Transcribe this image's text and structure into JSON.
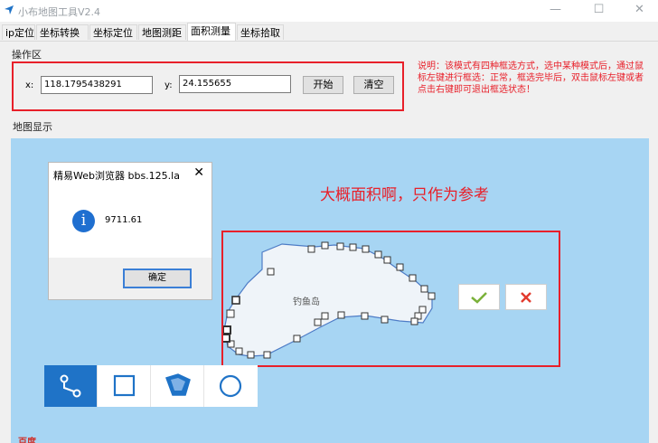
{
  "window": {
    "title": "小布地图工具V2.4",
    "minimize": "—",
    "maximize": "☐",
    "close": "✕"
  },
  "tabs": [
    {
      "label": "ip定位",
      "active": false
    },
    {
      "label": "坐标转换",
      "active": false
    },
    {
      "label": "坐标定位",
      "active": false
    },
    {
      "label": "地图测距",
      "active": false
    },
    {
      "label": "面积测量",
      "active": true
    },
    {
      "label": "坐标拾取",
      "active": false
    }
  ],
  "operation": {
    "section_label": "操作区",
    "x_label": "x:",
    "x_value": "118.1795438291",
    "y_label": "y:",
    "y_value": "24.155655",
    "start_button": "开始",
    "clear_button": "清空",
    "description": "说明：该模式有四种框选方式，选中某种模式后，通过鼠标左键进行框选：正常，框选完毕后，双击鼠标左键或者点击右键即可退出框选状态！"
  },
  "map": {
    "section_label": "地图显示",
    "annotation": "大概面积啊，只作为参考",
    "island_label": "钓鱼岛",
    "confirm_icon": "check-icon",
    "cancel_icon": "x-icon",
    "tools": [
      "polyline-icon",
      "rectangle-icon",
      "polygon-icon",
      "circle-icon"
    ],
    "active_tool": "polyline-icon",
    "logo_text": "百度"
  },
  "dialog": {
    "title": "精易Web浏览器 bbs.125.la",
    "close": "✕",
    "icon": "info-icon",
    "message": "9711.61",
    "ok_button": "确定"
  },
  "colors": {
    "accent_red": "#e8202a",
    "map_water": "#a7d5f3",
    "toolbar_active": "#1f73c7",
    "confirm_green": "#7bb13a",
    "cancel_red": "#e23b2e"
  }
}
